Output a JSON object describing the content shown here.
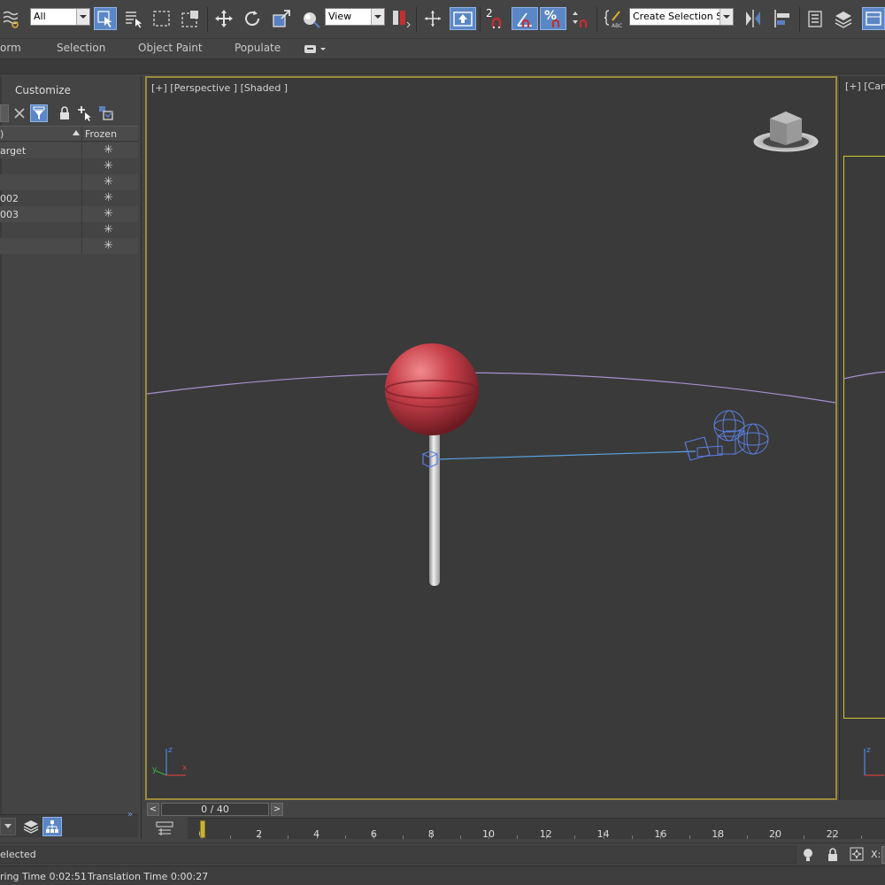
{
  "toolbar": {
    "selection_filter": "All",
    "ref_coord_system": "View",
    "snap_toggle_label": "2",
    "percent_snap_label": "%",
    "named_selection_placeholder": "Create Selection Se"
  },
  "ribbon": {
    "tabs": [
      "orm",
      "Selection",
      "Object Paint",
      "Populate"
    ]
  },
  "explorer": {
    "menu_label": "Customize",
    "col_name_header": ")",
    "col_frozen_header": "Frozen",
    "rows": [
      {
        "name": "arget",
        "frozen": "✳"
      },
      {
        "name": "",
        "frozen": "✳"
      },
      {
        "name": "",
        "frozen": "✳"
      },
      {
        "name": "002",
        "frozen": "✳"
      },
      {
        "name": "003",
        "frozen": "✳"
      },
      {
        "name": "",
        "frozen": "✳"
      },
      {
        "name": "",
        "frozen": "✳"
      }
    ]
  },
  "viewport": {
    "label": "[+] [Perspective ] [Shaded ]",
    "right_label": "[+] [Cam"
  },
  "timeslider": {
    "position": "0 / 40",
    "prev": "<",
    "next": ">",
    "ticks": [
      "0",
      "2",
      "4",
      "6",
      "8",
      "10",
      "12",
      "14",
      "16",
      "18",
      "20",
      "22"
    ]
  },
  "status": {
    "selection_text": "elected",
    "rendering_time": "ring Time  0:02:51",
    "translation_time": "Translation Time  0:00:27",
    "coord_label": "X:"
  },
  "colors": {
    "viewport_border_active": "#9c8a3c",
    "camera_frame": "#d2c62e",
    "lollipop": "#c8404a",
    "camera_wire": "#5a7ee0",
    "horizon": "#a890d0"
  }
}
